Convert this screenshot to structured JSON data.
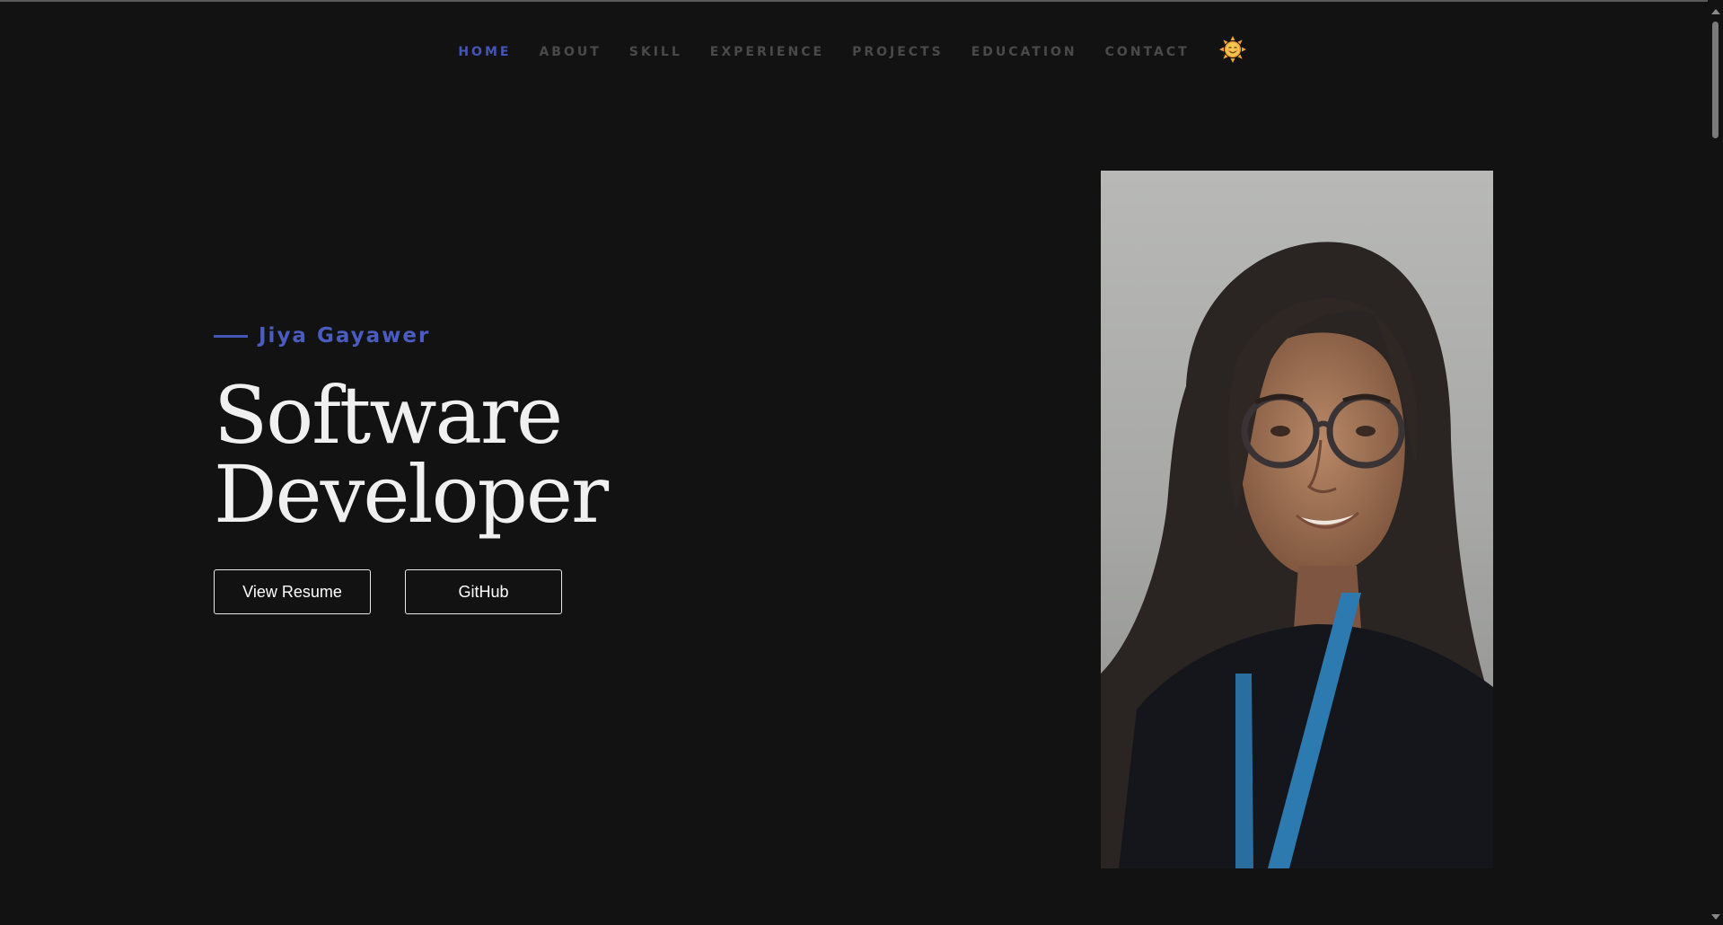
{
  "nav": {
    "items": [
      {
        "label": "HOME",
        "active": true
      },
      {
        "label": "ABOUT",
        "active": false
      },
      {
        "label": "SKILL",
        "active": false
      },
      {
        "label": "EXPERIENCE",
        "active": false
      },
      {
        "label": "PROJECTS",
        "active": false
      },
      {
        "label": "EDUCATION",
        "active": false
      },
      {
        "label": "CONTACT",
        "active": false
      }
    ],
    "theme_icon": "smiling-sun-icon"
  },
  "hero": {
    "name": "Jiya Gayawer",
    "title_line1": "Software",
    "title_line2": "Developer",
    "buttons": {
      "resume": "View Resume",
      "github": "GitHub"
    },
    "portrait_icon": "profile-photo"
  },
  "colors": {
    "background": "#121212",
    "accent": "#4356b6",
    "nav_inactive": "#4a4a4a",
    "text": "#f0f0f0"
  }
}
